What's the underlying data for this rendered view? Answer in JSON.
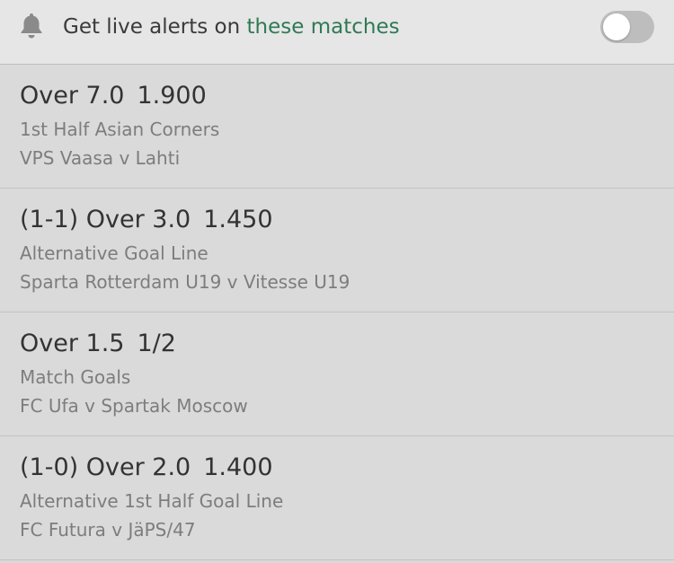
{
  "alerts": {
    "icon": "bell-icon",
    "label_prefix": "Get live alerts on ",
    "label_link": "these matches",
    "link_color": "#2f7a54",
    "toggle_state": "off"
  },
  "bets": [
    {
      "selection": "Over 7.0",
      "odds": "1.900",
      "market": "1st Half Asian Corners",
      "event": "VPS Vaasa v Lahti"
    },
    {
      "selection": "(1-1) Over 3.0",
      "odds": "1.450",
      "market": "Alternative Goal Line",
      "event": "Sparta Rotterdam U19 v Vitesse U19"
    },
    {
      "selection": "Over 1.5",
      "odds": "1/2",
      "market": "Match Goals",
      "event": "FC Ufa v Spartak Moscow"
    },
    {
      "selection": "(1-0) Over 2.0",
      "odds": "1.400",
      "market": "Alternative 1st Half Goal Line",
      "event": "FC Futura v JäPS/47"
    }
  ]
}
